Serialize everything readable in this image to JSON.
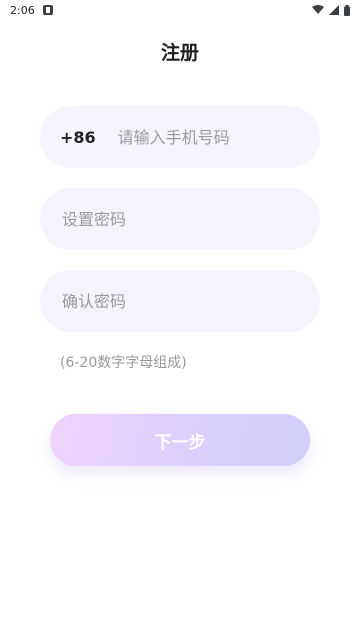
{
  "status_bar": {
    "time": "2:06",
    "icons": [
      "notification-icon",
      "wifi-icon",
      "signal-icon",
      "battery-icon"
    ]
  },
  "page": {
    "title": "注册"
  },
  "form": {
    "phone": {
      "prefix": "+86",
      "placeholder": "请输入手机号码",
      "value": ""
    },
    "password": {
      "placeholder": "设置密码",
      "value": ""
    },
    "confirm_password": {
      "placeholder": "确认密码",
      "value": ""
    },
    "hint": "(6-20数字字母组成)"
  },
  "next_button": {
    "label": "下一步"
  },
  "colors": {
    "field_bg": "#f4f4fd",
    "button_gradient_start": "#efd3fb",
    "button_gradient_end": "#d2cffb"
  }
}
